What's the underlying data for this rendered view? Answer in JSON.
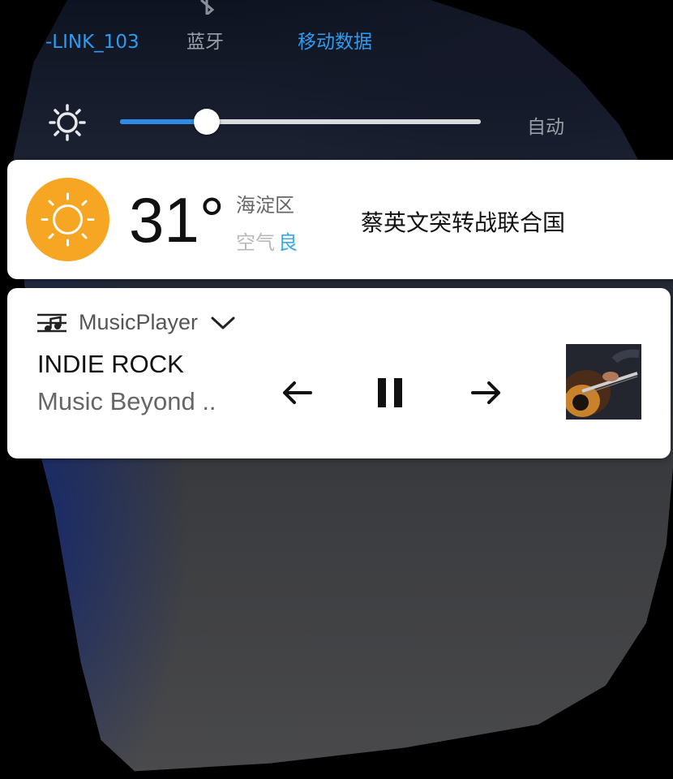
{
  "quick_settings": {
    "wifi_label": "-LINK_103",
    "bluetooth_label": "蓝牙",
    "mobile_data_label": "移动数据",
    "active_color": "#2e9bf0",
    "inactive_color": "#9aa0a8"
  },
  "brightness": {
    "level": 0.24,
    "auto_label": "自动"
  },
  "weather": {
    "temperature": "31°",
    "location": "海淀区",
    "air_label": "空气",
    "air_quality": "良",
    "headline": "蔡英文突转战联合国",
    "icon": "sun-icon",
    "badge_color": "#f6a623"
  },
  "music": {
    "app_name": "MusicPlayer",
    "title": "INDIE ROCK",
    "artist": "Music Beyond ..",
    "controls": {
      "prev_icon": "arrow-left-icon",
      "pause_icon": "pause-icon",
      "next_icon": "arrow-right-icon"
    }
  }
}
